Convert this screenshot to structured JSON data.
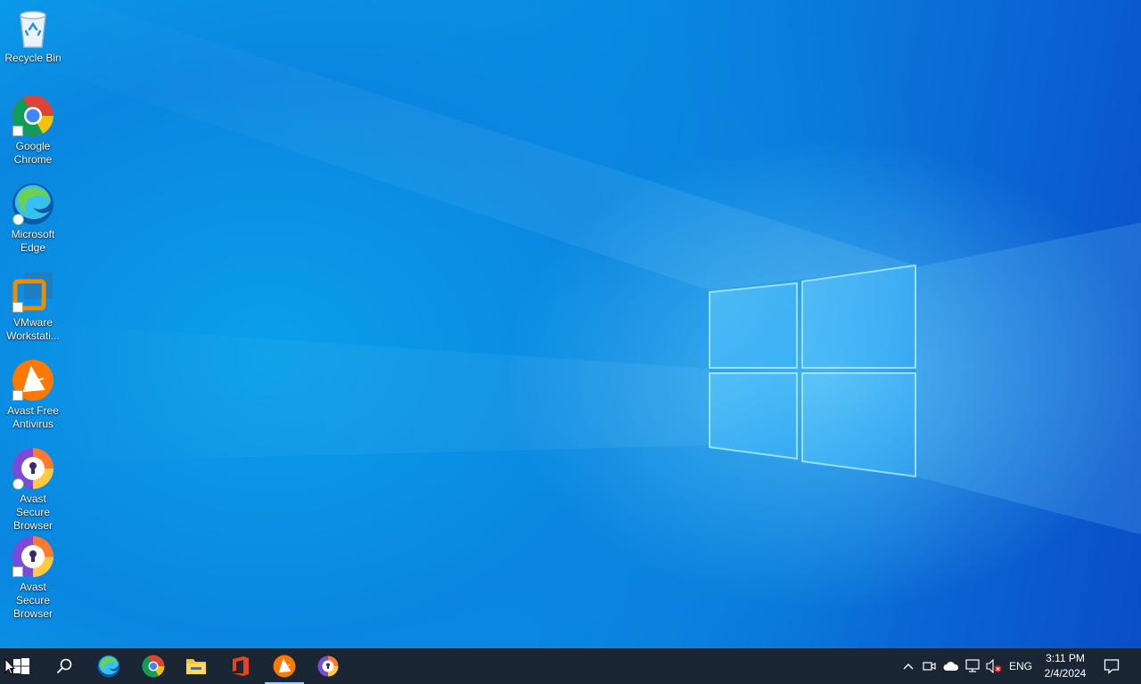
{
  "desktop": {
    "icons": [
      {
        "name": "recycle-bin-icon",
        "label": "Recycle Bin"
      },
      {
        "name": "google-chrome-icon",
        "label": "Google Chrome"
      },
      {
        "name": "microsoft-edge-icon",
        "label": "Microsoft Edge"
      },
      {
        "name": "vmware-workstation-icon",
        "label": "VMware Workstati..."
      },
      {
        "name": "avast-free-antivirus-icon",
        "label": "Avast Free Antivirus"
      },
      {
        "name": "avast-secure-browser-icon",
        "label": "Avast Secure Browser"
      },
      {
        "name": "avast-secure-browser-icon",
        "label": "Avast Secure Browser"
      }
    ]
  },
  "taskbar": {
    "items": [
      "start-button",
      "search-button",
      "microsoft-edge",
      "google-chrome",
      "file-explorer",
      "office",
      "avast-free-antivirus",
      "avast-secure-browser"
    ],
    "tray": {
      "language": "ENG",
      "time": "3:11 PM",
      "date": "2/4/2024"
    }
  },
  "colors": {
    "taskbar": "#1b2634",
    "desktop_accent": "#0796e6",
    "active_indicator": "#9ecbff"
  }
}
